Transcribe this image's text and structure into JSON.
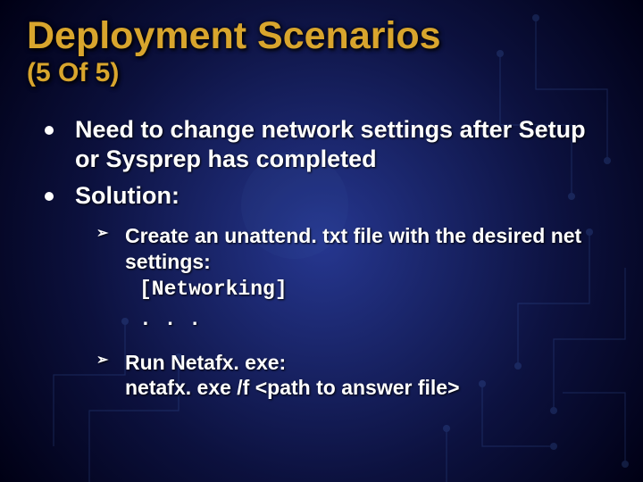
{
  "title": "Deployment Scenarios",
  "subtitle": "(5 Of 5)",
  "bullets": [
    {
      "text": "Need to change network settings after Setup or Sysprep has completed"
    },
    {
      "text": "Solution:"
    }
  ],
  "subbullets": [
    {
      "lead": "Create an unattend. txt file with the desired net settings:",
      "code1": "[Networking]",
      "code2": ". . ."
    },
    {
      "line1": "Run Netafx. exe:",
      "line2": "netafx. exe /f <path to answer file>"
    }
  ]
}
